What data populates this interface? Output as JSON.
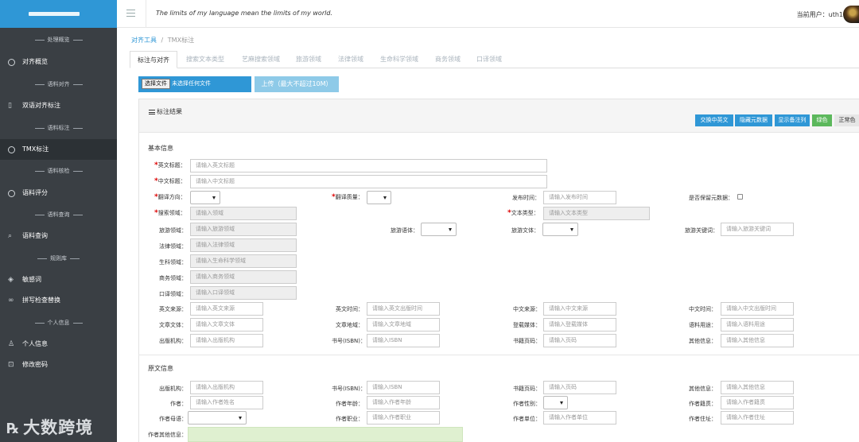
{
  "sidebar": {
    "brand": "logo",
    "sections": {
      "s1": "处理概览",
      "s2": "语料对齐",
      "s3": "语料标注",
      "s4": "语料核检",
      "s5": "语料查询",
      "s6": "规则库",
      "s7": "个人信息"
    },
    "items": {
      "overview": "对齐概览",
      "bilingual": "双语对齐标注",
      "tmx": "TMX标注",
      "score": "语料评分",
      "query": "语料查询",
      "sensitive": "敏感词",
      "spell": "拼写检查替换",
      "profile": "个人信息",
      "password": "修改密码"
    },
    "watermark": "大数跨境"
  },
  "header": {
    "quote": "The limits of my language mean the limits of my world.",
    "user_label": "当前用户：uth1"
  },
  "breadcrumb": {
    "root": "对齐工具",
    "sep": "/",
    "current": "TMX标注"
  },
  "tabs": [
    "标注与对齐",
    "搜索文本类型",
    "艺麻搜索领域",
    "旅游领域",
    "法律领域",
    "生命科学领域",
    "商务领域",
    "口译领域"
  ],
  "upload": {
    "choose": "选择文件",
    "no_file": "未选择任何文件",
    "upload_btn": "上传（最大不超过10M）"
  },
  "panel": {
    "title": "标注结果",
    "buttons": {
      "swap": "交换中英文",
      "hide_meta": "隐藏元数据",
      "show_notes": "显示备注列",
      "green": "绿色",
      "normal": "正常色"
    }
  },
  "basic": {
    "title": "基本信息",
    "en_title": {
      "label": "英文标题：",
      "ph": "请输入英文标题"
    },
    "zh_title": {
      "label": "中文标题：",
      "ph": "请输入中文标题"
    },
    "direction": {
      "label": "翻译方向："
    },
    "quality": {
      "label": "翻译质量："
    },
    "pub_time": {
      "label": "发布时间：",
      "ph": "请输入发布时间"
    },
    "keep_meta": {
      "label": "是否保留元数据："
    },
    "search_domain": {
      "label": "搜索领域：",
      "ph": "请输入领域"
    },
    "text_type": {
      "label": "文本类型：",
      "ph": "请输入文本类型"
    },
    "tour_domain": {
      "label": "旅游领域：",
      "ph": "请输入旅游领域"
    },
    "tour_style": {
      "label": "旅游语体："
    },
    "tour_text": {
      "label": "旅游文体："
    },
    "tour_kw": {
      "label": "旅游关键词：",
      "ph": "请输入旅游关键词"
    },
    "law_domain": {
      "label": "法律领域：",
      "ph": "请输入法律领域"
    },
    "bio_domain": {
      "label": "生科领域：",
      "ph": "请输入生命科学领域"
    },
    "biz_domain": {
      "label": "商务领域：",
      "ph": "请输入商务领域"
    },
    "interp_domain": {
      "label": "口译领域：",
      "ph": "请输入口译领域"
    },
    "en_source": {
      "label": "英文来源：",
      "ph": "请输入英文来源"
    },
    "en_time": {
      "label": "英文时间：",
      "ph": "请输入英文出版时间"
    },
    "zh_source": {
      "label": "中文来源：",
      "ph": "请输入中文来源"
    },
    "zh_time": {
      "label": "中文时间：",
      "ph": "请输入中文出版时间"
    },
    "style": {
      "label": "文章文体：",
      "ph": "请输入文章文体"
    },
    "region": {
      "label": "文章地域：",
      "ph": "请输入文章地域"
    },
    "media": {
      "label": "登载媒体：",
      "ph": "请输入登载媒体"
    },
    "usage": {
      "label": "语料用途：",
      "ph": "请输入语料用途"
    },
    "publisher": {
      "label": "出版机构：",
      "ph": "请输入出版机构"
    },
    "isbn": {
      "label": "书号(ISBN)：",
      "ph": "请输入ISBN"
    },
    "pages": {
      "label": "书籍页码：",
      "ph": "请输入页码"
    },
    "other": {
      "label": "其他信息：",
      "ph": "请输入其他信息"
    }
  },
  "original": {
    "title": "原文信息",
    "publisher": {
      "label": "出版机构：",
      "ph": "请输入出版机构"
    },
    "isbn": {
      "label": "书号(ISBN)：",
      "ph": "请输入ISBN"
    },
    "pages": {
      "label": "书籍页码：",
      "ph": "请输入页码"
    },
    "other": {
      "label": "其他信息：",
      "ph": "请输入其他信息"
    },
    "author": {
      "label": "作者：",
      "ph": "请输入作者姓名"
    },
    "age": {
      "label": "作者年龄：",
      "ph": "请输入作者年龄"
    },
    "gender": {
      "label": "作者性别："
    },
    "origin": {
      "label": "作者籍贯：",
      "ph": "请输入作者籍贯"
    },
    "mother_tongue": {
      "label": "作者母语："
    },
    "job": {
      "label": "作者职业：",
      "ph": "请输入作者职业"
    },
    "employer": {
      "label": "作者单位：",
      "ph": "请输入作者单位"
    },
    "address": {
      "label": "作者住址：",
      "ph": "请输入作者住址"
    },
    "extra": {
      "label": "作者其他信息："
    }
  },
  "colors": {
    "brand": "#2f97d6",
    "sidebar": "#3a3f44",
    "green_btn": "#5cb85c",
    "required": "#dd0000"
  }
}
